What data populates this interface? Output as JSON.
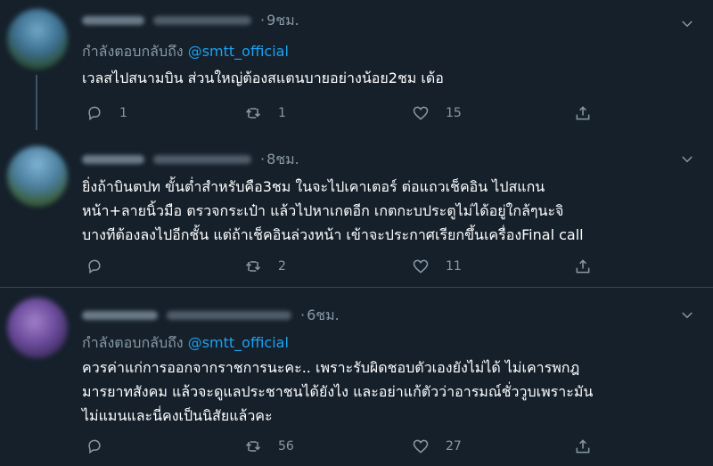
{
  "tweets": [
    {
      "time": "9ชม.",
      "reply_prefix": "กำลังตอบกลับถึง",
      "reply_handle": "@smtt_official",
      "lines": [
        "เวลสไปสนามบิน ส่วนใหญ่ต้องสแตนบายอย่างน้อย2ชม เด้อ"
      ],
      "replies": "1",
      "retweets": "1",
      "likes": "15"
    },
    {
      "time": "8ชม.",
      "lines": [
        "ยิ่งถ้าบินตปท ขั้นต่ำสำหรับคือ3ชม ในจะไปเคาเตอร์ ต่อแถวเช็คอิน ไปสแกน",
        "หน้า+ลายนิ้วมือ ตรวจกระเป๋า แล้วไปหาเกตอีก เกตกะบประตูไม่ได้อยู่ใกล้ๆนะจิ",
        "บางทีต้องลงไปอีกชั้น แต่ถ้าเช็คอินล่วงหน้า เข้าจะประกาศเรียกขึ้นเครื่องFinal call"
      ],
      "replies": "",
      "retweets": "2",
      "likes": "11"
    },
    {
      "time": "6ชม.",
      "reply_prefix": "กำลังตอบกลับถึง",
      "reply_handle": "@smtt_official",
      "lines": [
        "ควรค่าแก่การออกจากราชการนะคะ.. เพราะรับผิดชอบตัวเองยังไม่ได้ ไม่เคารพกฎ",
        "มารยาทสังคม แล้วจะดูแลประชาชนได้ยังไง และอย่าแก้ตัวว่าอารมณ์ชั่ววูบเพราะมัน",
        "ไม่แมนและนี่คงเป็นนิสัยแล้วคะ"
      ],
      "replies": "",
      "retweets": "56",
      "likes": "27"
    }
  ],
  "icons": {
    "reply": "reply-icon",
    "retweet": "retweet-icon",
    "like": "heart-icon",
    "share": "share-icon",
    "more": "chevron-down-icon"
  },
  "colors": {
    "background": "#15202b",
    "divider": "#38444d",
    "secondary_text": "#8899a6",
    "link": "#1da1f2",
    "primary_text": "#ffffff"
  }
}
